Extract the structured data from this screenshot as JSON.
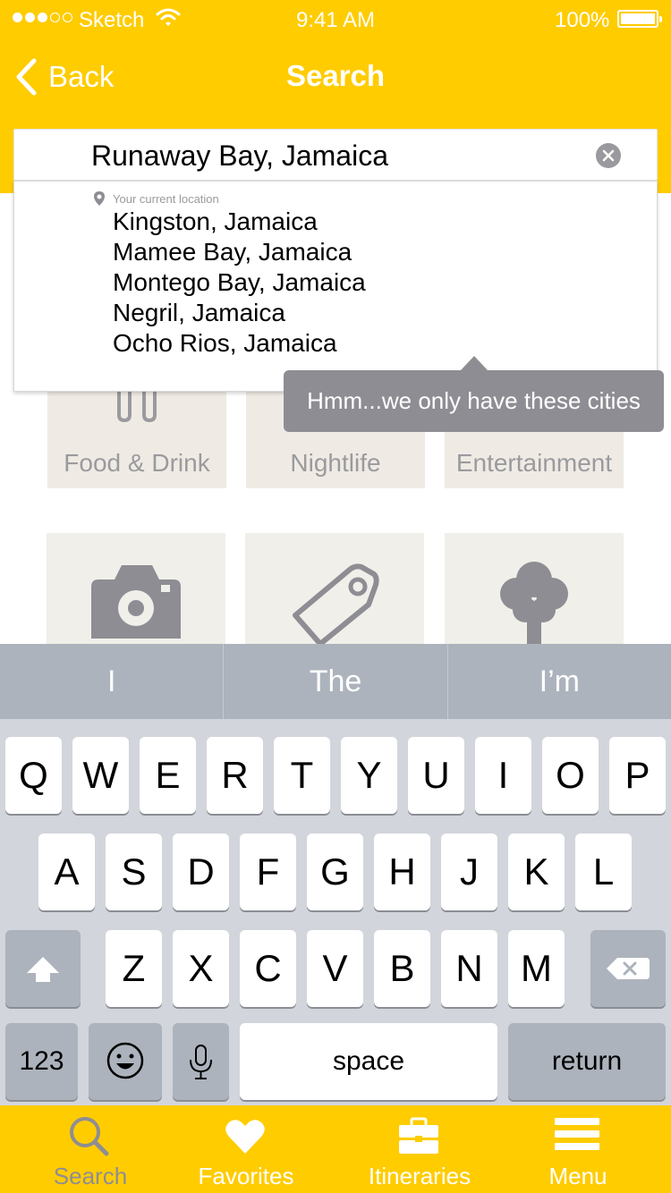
{
  "status_bar": {
    "carrier": "Sketch",
    "time": "9:41 AM",
    "battery": "100%"
  },
  "nav": {
    "back_label": "Back",
    "title": "Search"
  },
  "search": {
    "value": "Runaway Bay, Jamaica"
  },
  "dropdown": {
    "current_location_label": "Your current location",
    "suggestions": [
      "Kingston, Jamaica",
      "Mamee Bay, Jamaica",
      "Montego Bay, Jamaica",
      "Negril, Jamaica",
      "Ocho Rios, Jamaica"
    ]
  },
  "tooltip": {
    "text": "Hmm...we only have these cities"
  },
  "categories": [
    {
      "label": "Food & Drink",
      "icon": "fork-icon"
    },
    {
      "label": "Nightlife",
      "icon": "cocktail-icon"
    },
    {
      "label": "Entertainment",
      "icon": "ticket-icon"
    },
    {
      "label": "",
      "icon": "camera-icon"
    },
    {
      "label": "",
      "icon": "tag-icon"
    },
    {
      "label": "",
      "icon": "tree-icon"
    }
  ],
  "keyboard": {
    "predictions": [
      "I",
      "The",
      "I’m"
    ],
    "row1": [
      "Q",
      "W",
      "E",
      "R",
      "T",
      "Y",
      "U",
      "I",
      "O",
      "P"
    ],
    "row2": [
      "A",
      "S",
      "D",
      "F",
      "G",
      "H",
      "J",
      "K",
      "L"
    ],
    "row3": [
      "Z",
      "X",
      "C",
      "V",
      "B",
      "N",
      "M"
    ],
    "numbers_label": "123",
    "space_label": "space",
    "return_label": "return"
  },
  "tabs": [
    {
      "label": "Search",
      "icon": "search-icon",
      "active": true
    },
    {
      "label": "Favorites",
      "icon": "heart-icon",
      "active": false
    },
    {
      "label": "Itineraries",
      "icon": "briefcase-icon",
      "active": false
    },
    {
      "label": "Menu",
      "icon": "menu-icon",
      "active": false
    }
  ],
  "colors": {
    "brand_yellow": "#FFCC00",
    "tooltip_gray": "#8E8D93",
    "tile_bg": "#F0EFE9",
    "keyboard_bg": "#D2D5DB"
  }
}
